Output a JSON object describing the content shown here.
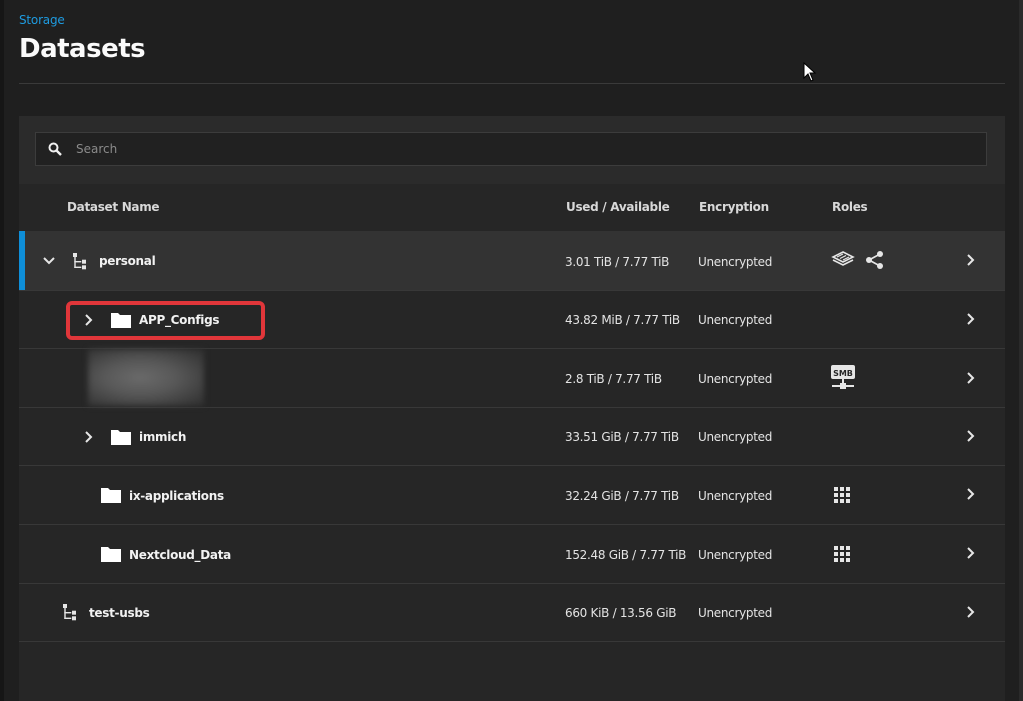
{
  "header": {
    "breadcrumb": "Storage",
    "title": "Datasets"
  },
  "search": {
    "placeholder": "Search",
    "value": ""
  },
  "table": {
    "columns": [
      "Dataset Name",
      "Used / Available",
      "Encryption",
      "Roles"
    ],
    "rows": [
      {
        "name": "personal",
        "used": "3.01 TiB / 7.77 TiB",
        "encryption": "Unencrypted",
        "roles": [
          "stack-layers-icon",
          "share-icon"
        ],
        "icon": "dataset-root-icon",
        "expander": "expanded"
      },
      {
        "name": "APP_Configs",
        "used": "43.82 MiB / 7.77 TiB",
        "encryption": "Unencrypted",
        "roles": [],
        "icon": "folder-icon",
        "expander": "collapsed"
      },
      {
        "name": "",
        "used": "2.8 TiB / 7.77 TiB",
        "encryption": "Unencrypted",
        "roles": [
          "smb-share-icon"
        ],
        "icon": "blurred",
        "expander": "none"
      },
      {
        "name": "immich",
        "used": "33.51 GiB / 7.77 TiB",
        "encryption": "Unencrypted",
        "roles": [],
        "icon": "folder-icon",
        "expander": "collapsed"
      },
      {
        "name": "ix-applications",
        "used": "32.24 GiB / 7.77 TiB",
        "encryption": "Unencrypted",
        "roles": [
          "apps-grid-icon"
        ],
        "icon": "folder-icon",
        "expander": "none"
      },
      {
        "name": "Nextcloud_Data",
        "used": "152.48 GiB / 7.77 TiB",
        "encryption": "Unencrypted",
        "roles": [
          "apps-grid-icon"
        ],
        "icon": "folder-icon",
        "expander": "none"
      },
      {
        "name": "test-usbs",
        "used": "660 KiB / 13.56 GiB",
        "encryption": "Unencrypted",
        "roles": [],
        "icon": "dataset-root-icon",
        "expander": "none"
      }
    ]
  },
  "colors": {
    "accent": "#0e8ed8",
    "highlight": "#e0363a",
    "breadcrumb": "#1e9be0"
  },
  "icons": {
    "smb_label": "SMB"
  }
}
